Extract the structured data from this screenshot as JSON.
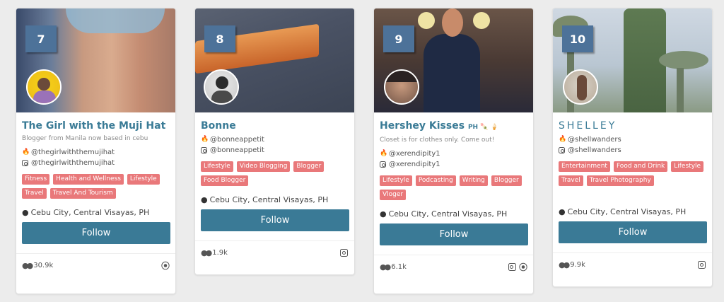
{
  "cards": [
    {
      "rank": "7",
      "name": "The Girl with the Muji Hat",
      "name_suffix": "",
      "bio": "Blogger from Manila now based in cebu",
      "handle_primary": "@thegirlwiththemujihat",
      "handle_instagram": "@thegirlwiththemujihat",
      "tags": [
        "Fitness",
        "Health and Wellness",
        "Lifestyle",
        "Travel",
        "Travel And Tourism"
      ],
      "location": "Cebu City, Central Visayas, PH",
      "follow_label": "Follow",
      "followers": "30.9k",
      "footer_icons": [
        "rss-icon"
      ]
    },
    {
      "rank": "8",
      "name": "Bonne",
      "name_suffix": "",
      "bio": "",
      "handle_primary": "@bonneappetit",
      "handle_instagram": "@bonneappetit",
      "tags": [
        "Lifestyle",
        "Video Blogging",
        "Blogger",
        "Food Blogger"
      ],
      "location": "Cebu City, Central Visayas, PH",
      "follow_label": "Follow",
      "followers": "1.9k",
      "footer_icons": [
        "instagram-icon"
      ]
    },
    {
      "rank": "9",
      "name": "Hershey Kisses",
      "name_suffix": "PH 🍡 🍦",
      "bio": "Closet is for clothes only. Come out!",
      "handle_primary": "@xerendipity1",
      "handle_instagram": "@xerendipity1",
      "tags": [
        "Lifestyle",
        "Podcasting",
        "Writing",
        "Blogger",
        "Vloger"
      ],
      "location": "Cebu City, Central Visayas, PH",
      "follow_label": "Follow",
      "followers": "6.1k",
      "footer_icons": [
        "instagram-icon",
        "rss-icon"
      ]
    },
    {
      "rank": "10",
      "name": "SHELLEY",
      "name_suffix": "",
      "bio": "",
      "handle_primary": "@shellwanders",
      "handle_instagram": "@shellwanders",
      "tags": [
        "Entertainment",
        "Food and Drink",
        "Lifestyle",
        "Travel",
        "Travel Photography"
      ],
      "location": "Cebu City, Central Visayas, PH",
      "follow_label": "Follow",
      "followers": "9.9k",
      "footer_icons": [
        "instagram-icon"
      ]
    }
  ],
  "colors": {
    "accent": "#3a7a96",
    "badge": "#4d7299",
    "tag": "#e9787a",
    "background": "#ececec"
  }
}
